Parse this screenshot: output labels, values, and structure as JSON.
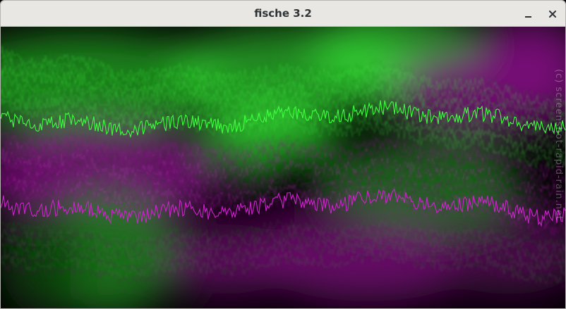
{
  "window": {
    "title": "fische 3.2"
  },
  "titlebar": {
    "minimize_icon": "minimize-icon",
    "close_icon": "close-icon"
  },
  "visualizer": {
    "watermark": "(c) screenshot-rapid-rain.net",
    "colors": {
      "green": "#3dff3d",
      "green_dim": "#1f8f1f",
      "purple": "#cc22cc",
      "purple_dim": "#7a0f7a",
      "background": "#050005"
    }
  }
}
